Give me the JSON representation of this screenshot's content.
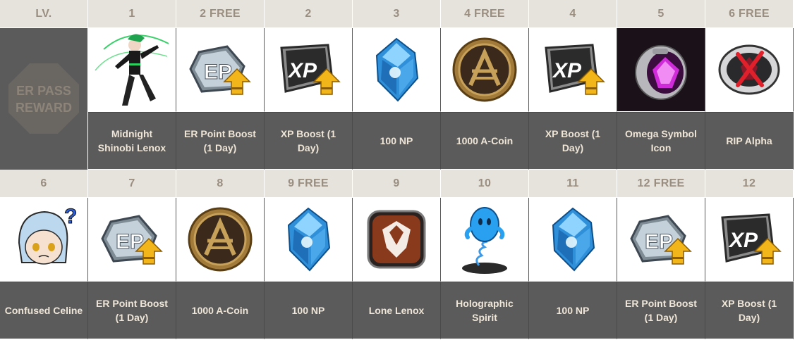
{
  "side_label": "LV.",
  "side_reward": [
    "ER PASS",
    "REWARD"
  ],
  "row1": [
    {
      "level": "1",
      "name": "Midnight Shinobi Lenox",
      "icon": "character-lenox-icon"
    },
    {
      "level": "2 FREE",
      "name": "ER Point Boost (1 Day)",
      "icon": "ep-boost-icon"
    },
    {
      "level": "2",
      "name": "XP Boost (1 Day)",
      "icon": "xp-boost-icon"
    },
    {
      "level": "3",
      "name": "100 NP",
      "icon": "np-crystal-icon"
    },
    {
      "level": "4 FREE",
      "name": "1000 A-Coin",
      "icon": "a-coin-icon"
    },
    {
      "level": "4",
      "name": "XP Boost (1 Day)",
      "icon": "xp-boost-icon"
    },
    {
      "level": "5",
      "name": "Omega Symbol Icon",
      "icon": "omega-symbol-icon"
    },
    {
      "level": "6 FREE",
      "name": "RIP Alpha",
      "icon": "rip-alpha-icon"
    }
  ],
  "row2": [
    {
      "level": "6",
      "name": "Confused Celine",
      "icon": "confused-celine-icon"
    },
    {
      "level": "7",
      "name": "ER Point Boost (1 Day)",
      "icon": "ep-boost-icon"
    },
    {
      "level": "8",
      "name": "1000 A-Coin",
      "icon": "a-coin-icon"
    },
    {
      "level": "9 FREE",
      "name": "100 NP",
      "icon": "np-crystal-icon"
    },
    {
      "level": "9",
      "name": "Lone Lenox",
      "icon": "lone-lenox-icon"
    },
    {
      "level": "10",
      "name": "Holographic Spirit",
      "icon": "holographic-spirit-icon"
    },
    {
      "level": "11",
      "name": "100 NP",
      "icon": "np-crystal-icon"
    },
    {
      "level": "12 FREE",
      "name": "ER Point Boost (1 Day)",
      "icon": "ep-boost-icon"
    },
    {
      "level": "12",
      "name": "XP Boost (1 Day)",
      "icon": "xp-boost-icon"
    }
  ],
  "colors": {
    "header_bg": "#e6e2dc",
    "header_text": "#9a8e80",
    "name_bg": "#5b5b5b",
    "name_text": "#efe6d8"
  }
}
